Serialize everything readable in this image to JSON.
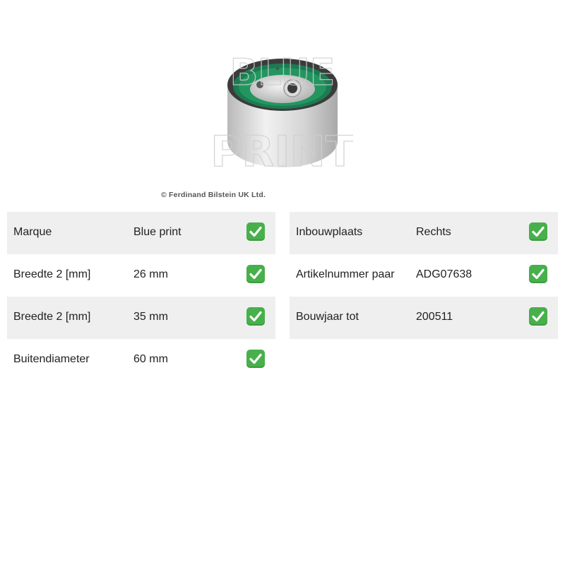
{
  "image": {
    "watermark_text": [
      "BLUE",
      "PRINT"
    ],
    "copyright": "© Ferdinand Bilstein UK Ltd."
  },
  "specs_left": [
    {
      "label": "Marque",
      "value": "Blue print",
      "icon": "check-mark-icon"
    },
    {
      "label": "Breedte 2 [mm]",
      "value": "26 mm",
      "icon": "check-mark-icon"
    },
    {
      "label": "Breedte 2 [mm]",
      "value": "35 mm",
      "icon": "check-mark-icon"
    },
    {
      "label": "Buitendiameter",
      "value": "60 mm",
      "icon": "check-mark-icon"
    }
  ],
  "specs_right": [
    {
      "label": "Inbouwplaats",
      "value": "Rechts",
      "icon": "check-mark-icon"
    },
    {
      "label": "Artikelnummer paar",
      "value": "ADG07638",
      "icon": "check-mark-icon"
    },
    {
      "label": "Bouwjaar tot",
      "value": "200511",
      "icon": "check-mark-icon"
    }
  ],
  "colors": {
    "row_shade": "#efefef",
    "check_green": "#47b04b",
    "pulley_green": "#1f8a5a"
  }
}
